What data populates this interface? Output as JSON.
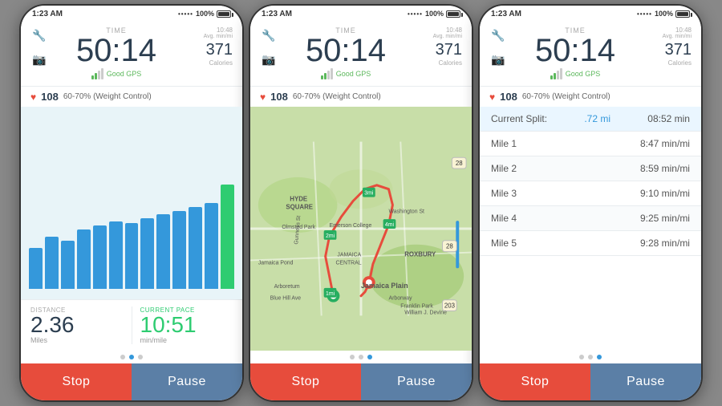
{
  "status_bar": {
    "time": "1:23 AM",
    "battery": "100%",
    "dots": "••••••"
  },
  "header": {
    "time_label": "TIME",
    "big_time": "50:14",
    "avg_label": "Avg. min/mi",
    "avg_value": "10:48",
    "gps_text": "Good GPS",
    "calories_value": "371",
    "calories_label": "Calories"
  },
  "heart": {
    "icon": "♥",
    "bpm": "108",
    "zone": "60-70% (Weight Control)"
  },
  "screen1": {
    "bars": [
      55,
      70,
      65,
      80,
      85,
      90,
      88,
      95,
      100,
      105,
      110,
      115,
      140
    ],
    "bar_colors": [
      "blue",
      "blue",
      "blue",
      "blue",
      "blue",
      "blue",
      "blue",
      "blue",
      "blue",
      "blue",
      "blue",
      "blue",
      "green"
    ],
    "distance_label": "DISTANCE",
    "distance_value": "2.36",
    "distance_unit": "Miles",
    "pace_label": "CURRENT PACE",
    "pace_value": "10:51",
    "pace_unit": "min/mile",
    "dots": [
      false,
      true,
      false
    ]
  },
  "screen2": {
    "dots": [
      false,
      false,
      true
    ],
    "stop_label": "Stop",
    "pause_label": "Pause"
  },
  "screen3": {
    "splits": [
      {
        "name": "Current Split:",
        "dist": ".72 mi",
        "pace": "08:52 min"
      },
      {
        "name": "Mile 1",
        "dist": "",
        "pace": "8:47 min/mi"
      },
      {
        "name": "Mile 2",
        "dist": "",
        "pace": "8:59 min/mi"
      },
      {
        "name": "Mile 3",
        "dist": "",
        "pace": "9:10 min/mi"
      },
      {
        "name": "Mile 4",
        "dist": "",
        "pace": "9:25 min/mi"
      },
      {
        "name": "Mile 5",
        "dist": "",
        "pace": "9:28 min/mi"
      }
    ],
    "dots": [
      false,
      false,
      true
    ]
  },
  "buttons": {
    "stop": "Stop",
    "pause": "Pause"
  }
}
